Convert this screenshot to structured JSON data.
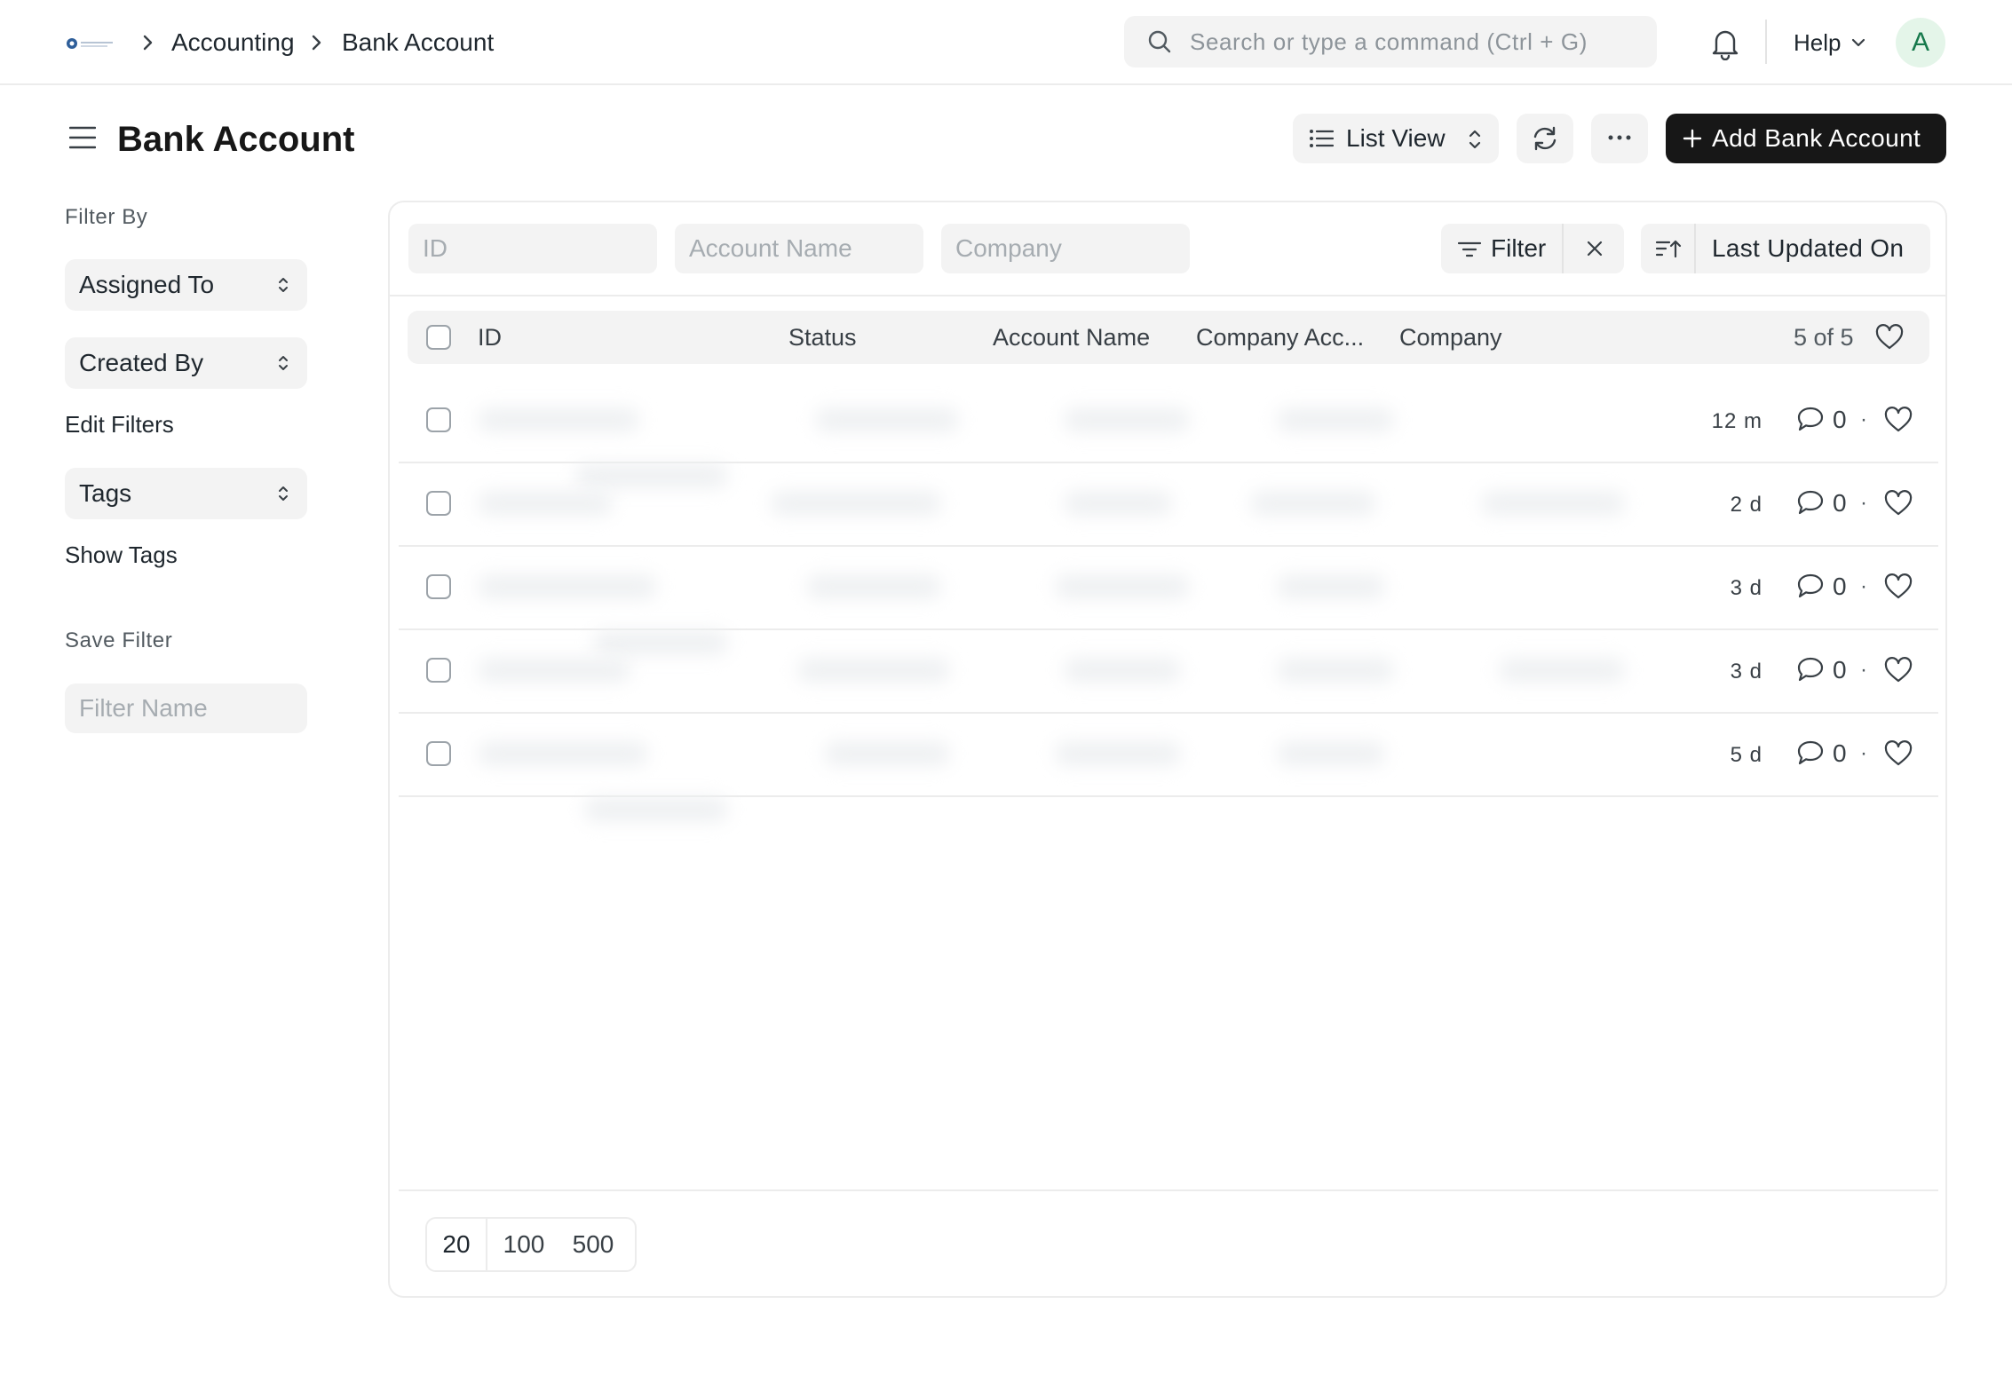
{
  "breadcrumb": [
    "Accounting",
    "Bank Account"
  ],
  "search": {
    "placeholder": "Search or type a command (Ctrl + G)"
  },
  "nav": {
    "help_label": "Help",
    "avatar_initial": "A"
  },
  "page": {
    "title": "Bank Account",
    "view_label": "List View",
    "primary_action": "Add Bank Account"
  },
  "sidebar": {
    "filter_by_label": "Filter By",
    "assigned_to": "Assigned To",
    "created_by": "Created By",
    "edit_filters": "Edit Filters",
    "tags": "Tags",
    "show_tags": "Show Tags",
    "save_filter_label": "Save Filter",
    "filter_name_placeholder": "Filter Name"
  },
  "filters": {
    "id_placeholder": "ID",
    "account_name_placeholder": "Account Name",
    "company_placeholder": "Company",
    "filter_label": "Filter",
    "sort_label": "Last Updated On"
  },
  "table": {
    "columns": [
      "ID",
      "Status",
      "Account Name",
      "Company Acc...",
      "Company"
    ],
    "count_text": "5 of 5",
    "rows": [
      {
        "time": "12 m",
        "comments": "0"
      },
      {
        "time": "2 d",
        "comments": "0"
      },
      {
        "time": "3 d",
        "comments": "0"
      },
      {
        "time": "3 d",
        "comments": "0"
      },
      {
        "time": "5 d",
        "comments": "0"
      }
    ]
  },
  "paging": [
    "20",
    "100",
    "500"
  ],
  "colors": {
    "primary_button": "#171717",
    "surface": "#f3f3f3",
    "avatar_bg": "#e4f5e9",
    "avatar_fg": "#16794c"
  }
}
